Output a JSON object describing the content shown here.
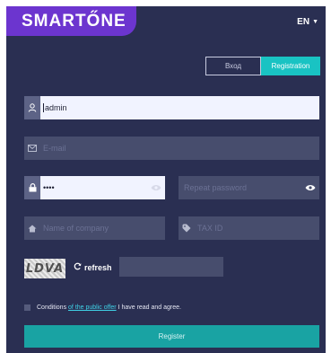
{
  "header": {
    "logo_text": "SMARTŐNE",
    "language": "EN",
    "brand_color": "#6c35cf"
  },
  "tabs": {
    "login_label": "Вход",
    "registration_label": "Registration",
    "active": "registration"
  },
  "form": {
    "username": {
      "value": "admin",
      "icon": "user-icon"
    },
    "email": {
      "placeholder": "E-mail",
      "icon": "mail-icon"
    },
    "password": {
      "value": "••••",
      "icon": "lock-icon"
    },
    "repeat_password": {
      "placeholder": "Repeat password"
    },
    "company": {
      "placeholder": "Name of company",
      "icon": "home-icon"
    },
    "tax_id": {
      "placeholder": "TAX ID",
      "icon": "tag-icon"
    },
    "captcha": {
      "code": "LDVA",
      "refresh_label": "refresh"
    },
    "terms": {
      "prefix": "Conditions ",
      "link": "of the public offer",
      "suffix": " I have read and agree."
    },
    "submit_label": "Register"
  },
  "colors": {
    "background": "#2a2f52",
    "field_dark": "#474d6d",
    "field_light": "#f1f3ff",
    "accent": "#19c3c3",
    "button": "#19a3a3"
  }
}
